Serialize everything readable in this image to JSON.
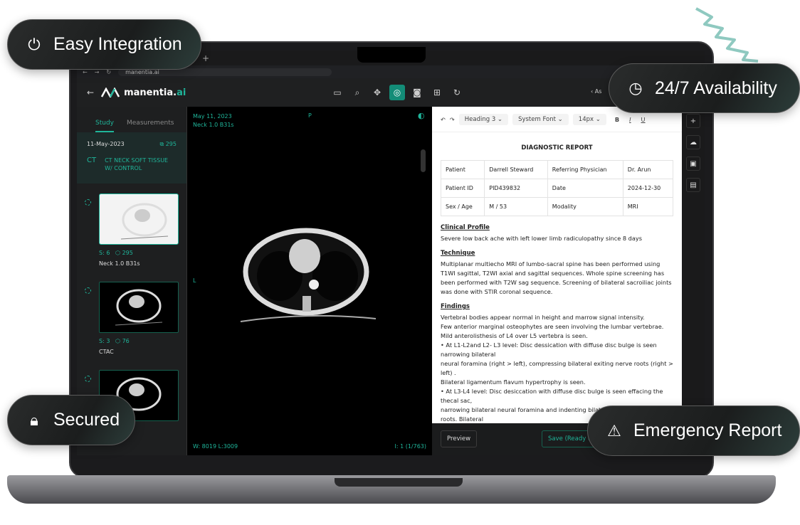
{
  "badges": {
    "integration": "Easy Integration",
    "availability": "24/7 Availability",
    "secured": "Secured",
    "emergency": "Emergency Report"
  },
  "browser": {
    "url": "manentia.ai",
    "new_tab": "+"
  },
  "app": {
    "logo_main": "manentia.",
    "logo_accent": "ai",
    "header_right": "As"
  },
  "sidebar": {
    "tabs": [
      "Study",
      "Measurements"
    ],
    "study": {
      "date": "11-May-2023",
      "count": "295",
      "modality": "CT",
      "description": "CT NECK SOFT TISSUE W/ CONTROL"
    },
    "series": [
      {
        "s": "S: 6",
        "count": "295",
        "name": "Neck 1.0 B31s"
      },
      {
        "s": "S: 3",
        "count": "76",
        "name": "CTAC"
      },
      {
        "s": "",
        "count": "",
        "name": ""
      }
    ]
  },
  "viewer": {
    "date": "May 11, 2023",
    "series": "Neck 1.0 B31s",
    "orient_top": "P",
    "orient_left": "L",
    "window_level": "W: 8019 L:3009",
    "image_index": "I: 1 (1/763)"
  },
  "editor": {
    "block": "Heading 3",
    "font": "System Font",
    "size": "14px",
    "bold": "B",
    "italic": "I",
    "underline": "U"
  },
  "report": {
    "title": "DIAGNOSTIC REPORT",
    "table": [
      [
        "Patient",
        "Darrell Steward",
        "Referring Physician",
        "Dr. Arun"
      ],
      [
        "Patient ID",
        "PID439832",
        "Date",
        "2024-12-30"
      ],
      [
        "Sex / Age",
        "M / 53",
        "Modality",
        "MRI"
      ]
    ],
    "clinical_heading": "Clinical Profile",
    "clinical": "Severe low back ache with left lower limb radiculopathy since 8 days",
    "technique_heading": "Technique",
    "technique": "Multiplanar multiecho MRI of lumbo-sacral spine has been performed using T1WI sagittal, T2WI axial and sagittal sequences. Whole spine screening has been performed with T2W sag sequence. Screening of bilateral sacroiliac joints was done with STIR coronal sequence.",
    "findings_heading": "Findings",
    "findings": [
      "Vertebral bodies appear normal in height and marrow signal intensity.",
      "Few anterior marginal osteophytes are seen involving the lumbar vertebrae.",
      "Mild anterolisthesis of L4 over L5 vertebra is seen.",
      "• At L1-L2and L2- L3 level: Disc dessication with diffuse disc bulge is seen narrowing bilateral",
      "neural foramina (right > left), compressing bilateral exiting nerve roots (right > left) .",
      "Bilateral ligamentum flavum hypertrophy is seen.",
      "• At L3-L4 level: Disc desiccation with diffuse disc bulge is seen effacing the thecal sac,",
      "narrowing bilateral neural foramina and indenting bilateral exiting nerve",
      "roots. Bilateral"
    ]
  },
  "footer": {
    "preview": "Preview",
    "save": "Save (Ready to sign)"
  },
  "colors": {
    "accent": "#1fb59a",
    "dark": "#121314"
  }
}
